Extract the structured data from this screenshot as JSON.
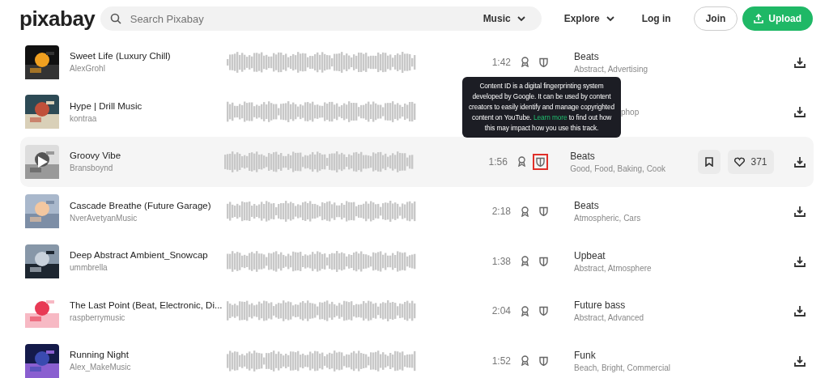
{
  "header": {
    "logo": "pixabay",
    "search": {
      "placeholder": "Search Pixabay"
    },
    "category": "Music",
    "nav": [
      {
        "label": "Explore",
        "dropdown": true
      },
      {
        "label": "Log in",
        "dropdown": false
      }
    ],
    "join": "Join",
    "upload": "Upload"
  },
  "tracks": [
    {
      "title": "Sweet Life (Luxury Chill)",
      "artist": "AlexGrohl",
      "duration": "1:42",
      "genre": "Beats",
      "tags": "Abstract, Advertising",
      "hovered": false
    },
    {
      "title": "Hype | Drill Music",
      "artist": "kontraa",
      "tags": "phop",
      "tags_clipped": true,
      "hovered": false
    },
    {
      "title": "Groovy Vibe",
      "artist": "Bransboynd",
      "duration": "1:56",
      "genre": "Beats",
      "tags": "Good, Food, Baking, Cook",
      "hovered": true,
      "highlighted": true,
      "likes": "371"
    },
    {
      "title": "Cascade Breathe (Future Garage)",
      "artist": "NverAvetyanMusic",
      "duration": "2:18",
      "genre": "Beats",
      "tags": "Atmospheric, Cars",
      "hovered": false
    },
    {
      "title": "Deep Abstract Ambient_Snowcap",
      "artist": "ummbrella",
      "duration": "1:38",
      "genre": "Upbeat",
      "tags": "Abstract, Atmosphere",
      "hovered": false
    },
    {
      "title": "The Last Point (Beat, Electronic, Di...",
      "artist": "raspberrymusic",
      "duration": "2:04",
      "genre": "Future bass",
      "tags": "Abstract, Advanced",
      "hovered": false
    },
    {
      "title": "Running Night",
      "artist": "Alex_MakeMusic",
      "duration": "1:52",
      "genre": "Funk",
      "tags": "Beach, Bright, Commercial",
      "hovered": false
    }
  ],
  "tooltip": {
    "before": "Content ID is a digital fingerprinting system developed by Google. It can be used by content creators to easily identify and manage copyrighted content on YouTube.",
    "link": "Learn more",
    "after": "to find out how this may impact how you use this track."
  }
}
